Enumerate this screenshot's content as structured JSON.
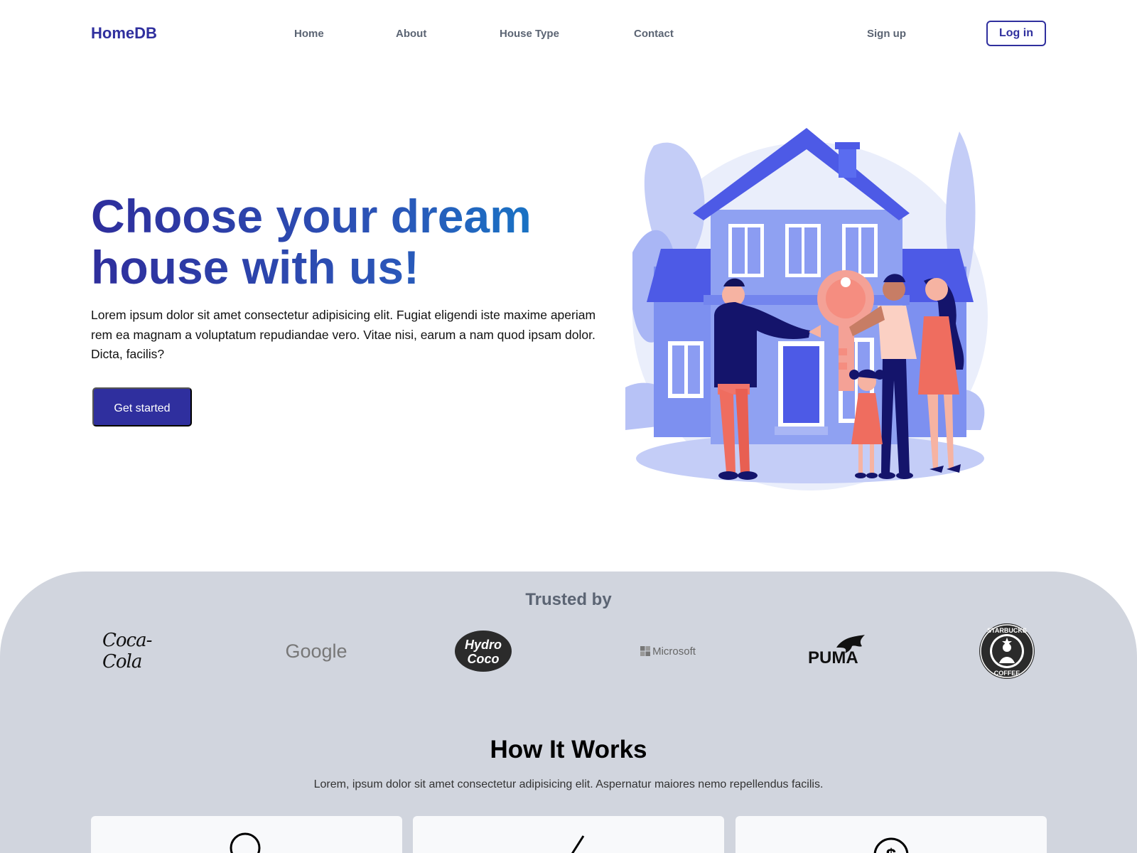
{
  "nav": {
    "logo": "HomeDB",
    "links": [
      "Home",
      "About",
      "House Type",
      "Contact"
    ],
    "signup": "Sign up",
    "login": "Log in"
  },
  "hero": {
    "title": "Choose your dream house with us!",
    "text": "Lorem ipsum dolor sit amet consectetur adipisicing elit. Fugiat eligendi iste maxime aperiam rem ea magnam a voluptatum repudiandae vero. Vitae nisi, earum a nam quod ipsam dolor. Dicta, facilis?",
    "cta": "Get started"
  },
  "trusted": {
    "title": "Trusted by",
    "brands": [
      {
        "name": "Coca-Cola",
        "text": "Coca-Cola"
      },
      {
        "name": "Google",
        "text": "Google"
      },
      {
        "name": "Hydro Coco",
        "text": "Hydro Coco"
      },
      {
        "name": "Microsoft",
        "text": "Microsoft"
      },
      {
        "name": "Puma",
        "text": "PUMA"
      },
      {
        "name": "Starbucks",
        "text": "STARBUCKS COFFEE"
      }
    ]
  },
  "how": {
    "title": "How It Works",
    "subtitle": "Lorem, ipsum dolor sit amet consectetur adipisicing elit. Aspernatur maiores nemo repellendus facilis.",
    "cards": [
      {
        "icon": "search-icon"
      },
      {
        "icon": "check-icon"
      },
      {
        "icon": "dollar-icon"
      }
    ]
  },
  "colors": {
    "brand": "#2f2f9e",
    "accent_blue": "#0e87cc",
    "band": "#d1d5de",
    "illustration_blue": "#5a6cf0",
    "illustration_coral": "#f0756a"
  }
}
